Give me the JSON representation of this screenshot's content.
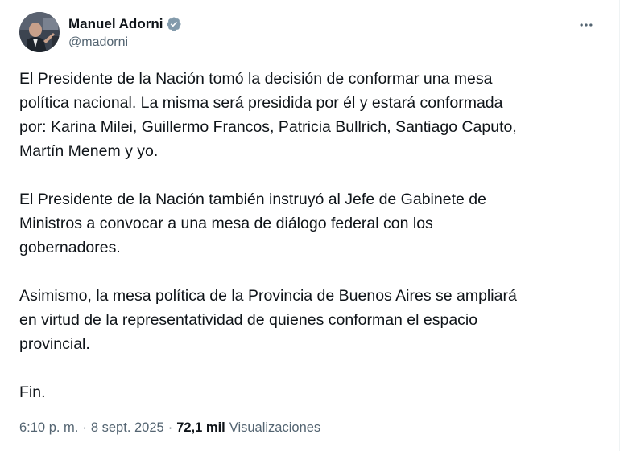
{
  "author": {
    "name": "Manuel Adorni",
    "handle": "@madorni",
    "verified": true,
    "verified_color": "#829aab"
  },
  "more_icon": "more-horizontal-icon",
  "tweet": {
    "paragraphs": [
      [
        "El Presidente de la Nación tomó la decisión de conformar una mesa",
        "política nacional. La misma será presidida por él y estará conformada",
        "por: Karina Milei, Guillermo Francos, Patricia Bullrich, Santiago Caputo,",
        "Martín Menem y yo."
      ],
      [
        "El Presidente de la Nación también instruyó al Jefe de Gabinete de",
        "Ministros a convocar a una mesa de diálogo federal con los",
        "gobernadores."
      ],
      [
        "Asimismo, la mesa política de la Provincia de Buenos Aires se ampliará",
        "en virtud de la representatividad de quienes conforman el espacio",
        "provincial."
      ],
      [
        "Fin."
      ]
    ]
  },
  "meta": {
    "time": "6:10 p. m.",
    "separator": "·",
    "date": "8 sept. 2025",
    "views_count": "72,1 mil",
    "views_label": "Visualizaciones"
  },
  "colors": {
    "text": "#0f1419",
    "secondary": "#536471"
  }
}
